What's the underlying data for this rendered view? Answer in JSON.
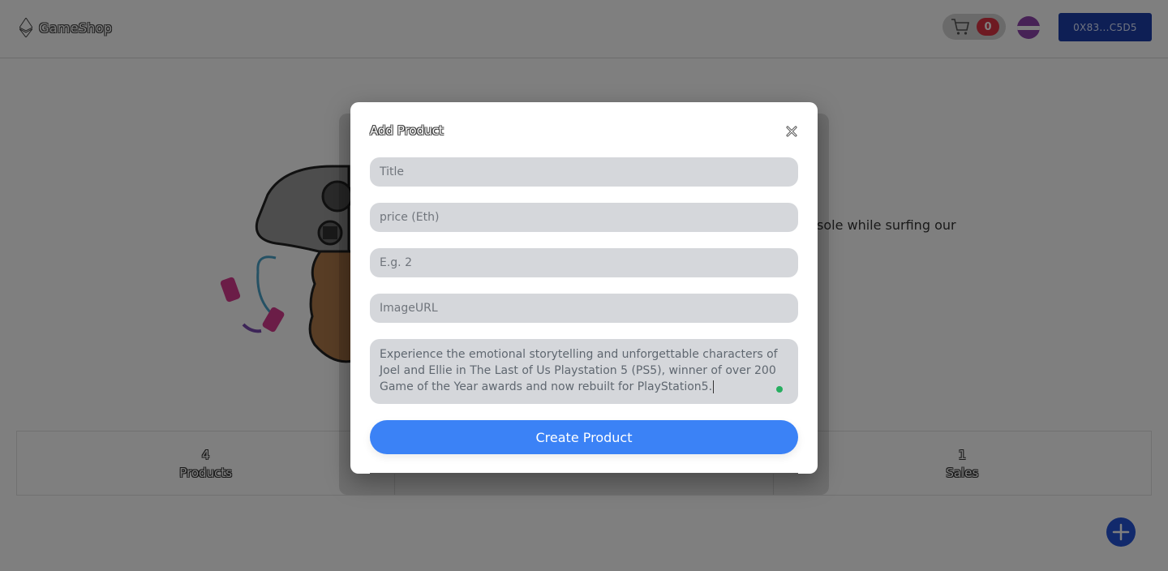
{
  "header": {
    "brand_name": "GameShop",
    "cart_count": "0",
    "wallet_address": "0X83...C5D5"
  },
  "hero": {
    "text_fragment": "sole while surfing our"
  },
  "stats": [
    {
      "value": "4",
      "label": "Products"
    },
    {
      "value": "",
      "label": ""
    },
    {
      "value": "1",
      "label": "Sales"
    }
  ],
  "modal": {
    "title": "Add Product",
    "fields": {
      "title_placeholder": "Title",
      "price_placeholder": "price (Eth)",
      "quantity_placeholder": "E.g. 2",
      "image_placeholder": "ImageURL"
    },
    "description": "Experience the emotional storytelling and unforgettable characters of Joel and Ellie in The Last of Us Playstation 5 (PS5), winner of over 200 Game of the Year awards and now rebuilt for PlayStation5.",
    "submit_label": "Create Product"
  },
  "colors": {
    "accent": "#3b82f6",
    "wallet": "#1c3faa",
    "badge": "#dc3545",
    "fab": "#2555d8"
  }
}
